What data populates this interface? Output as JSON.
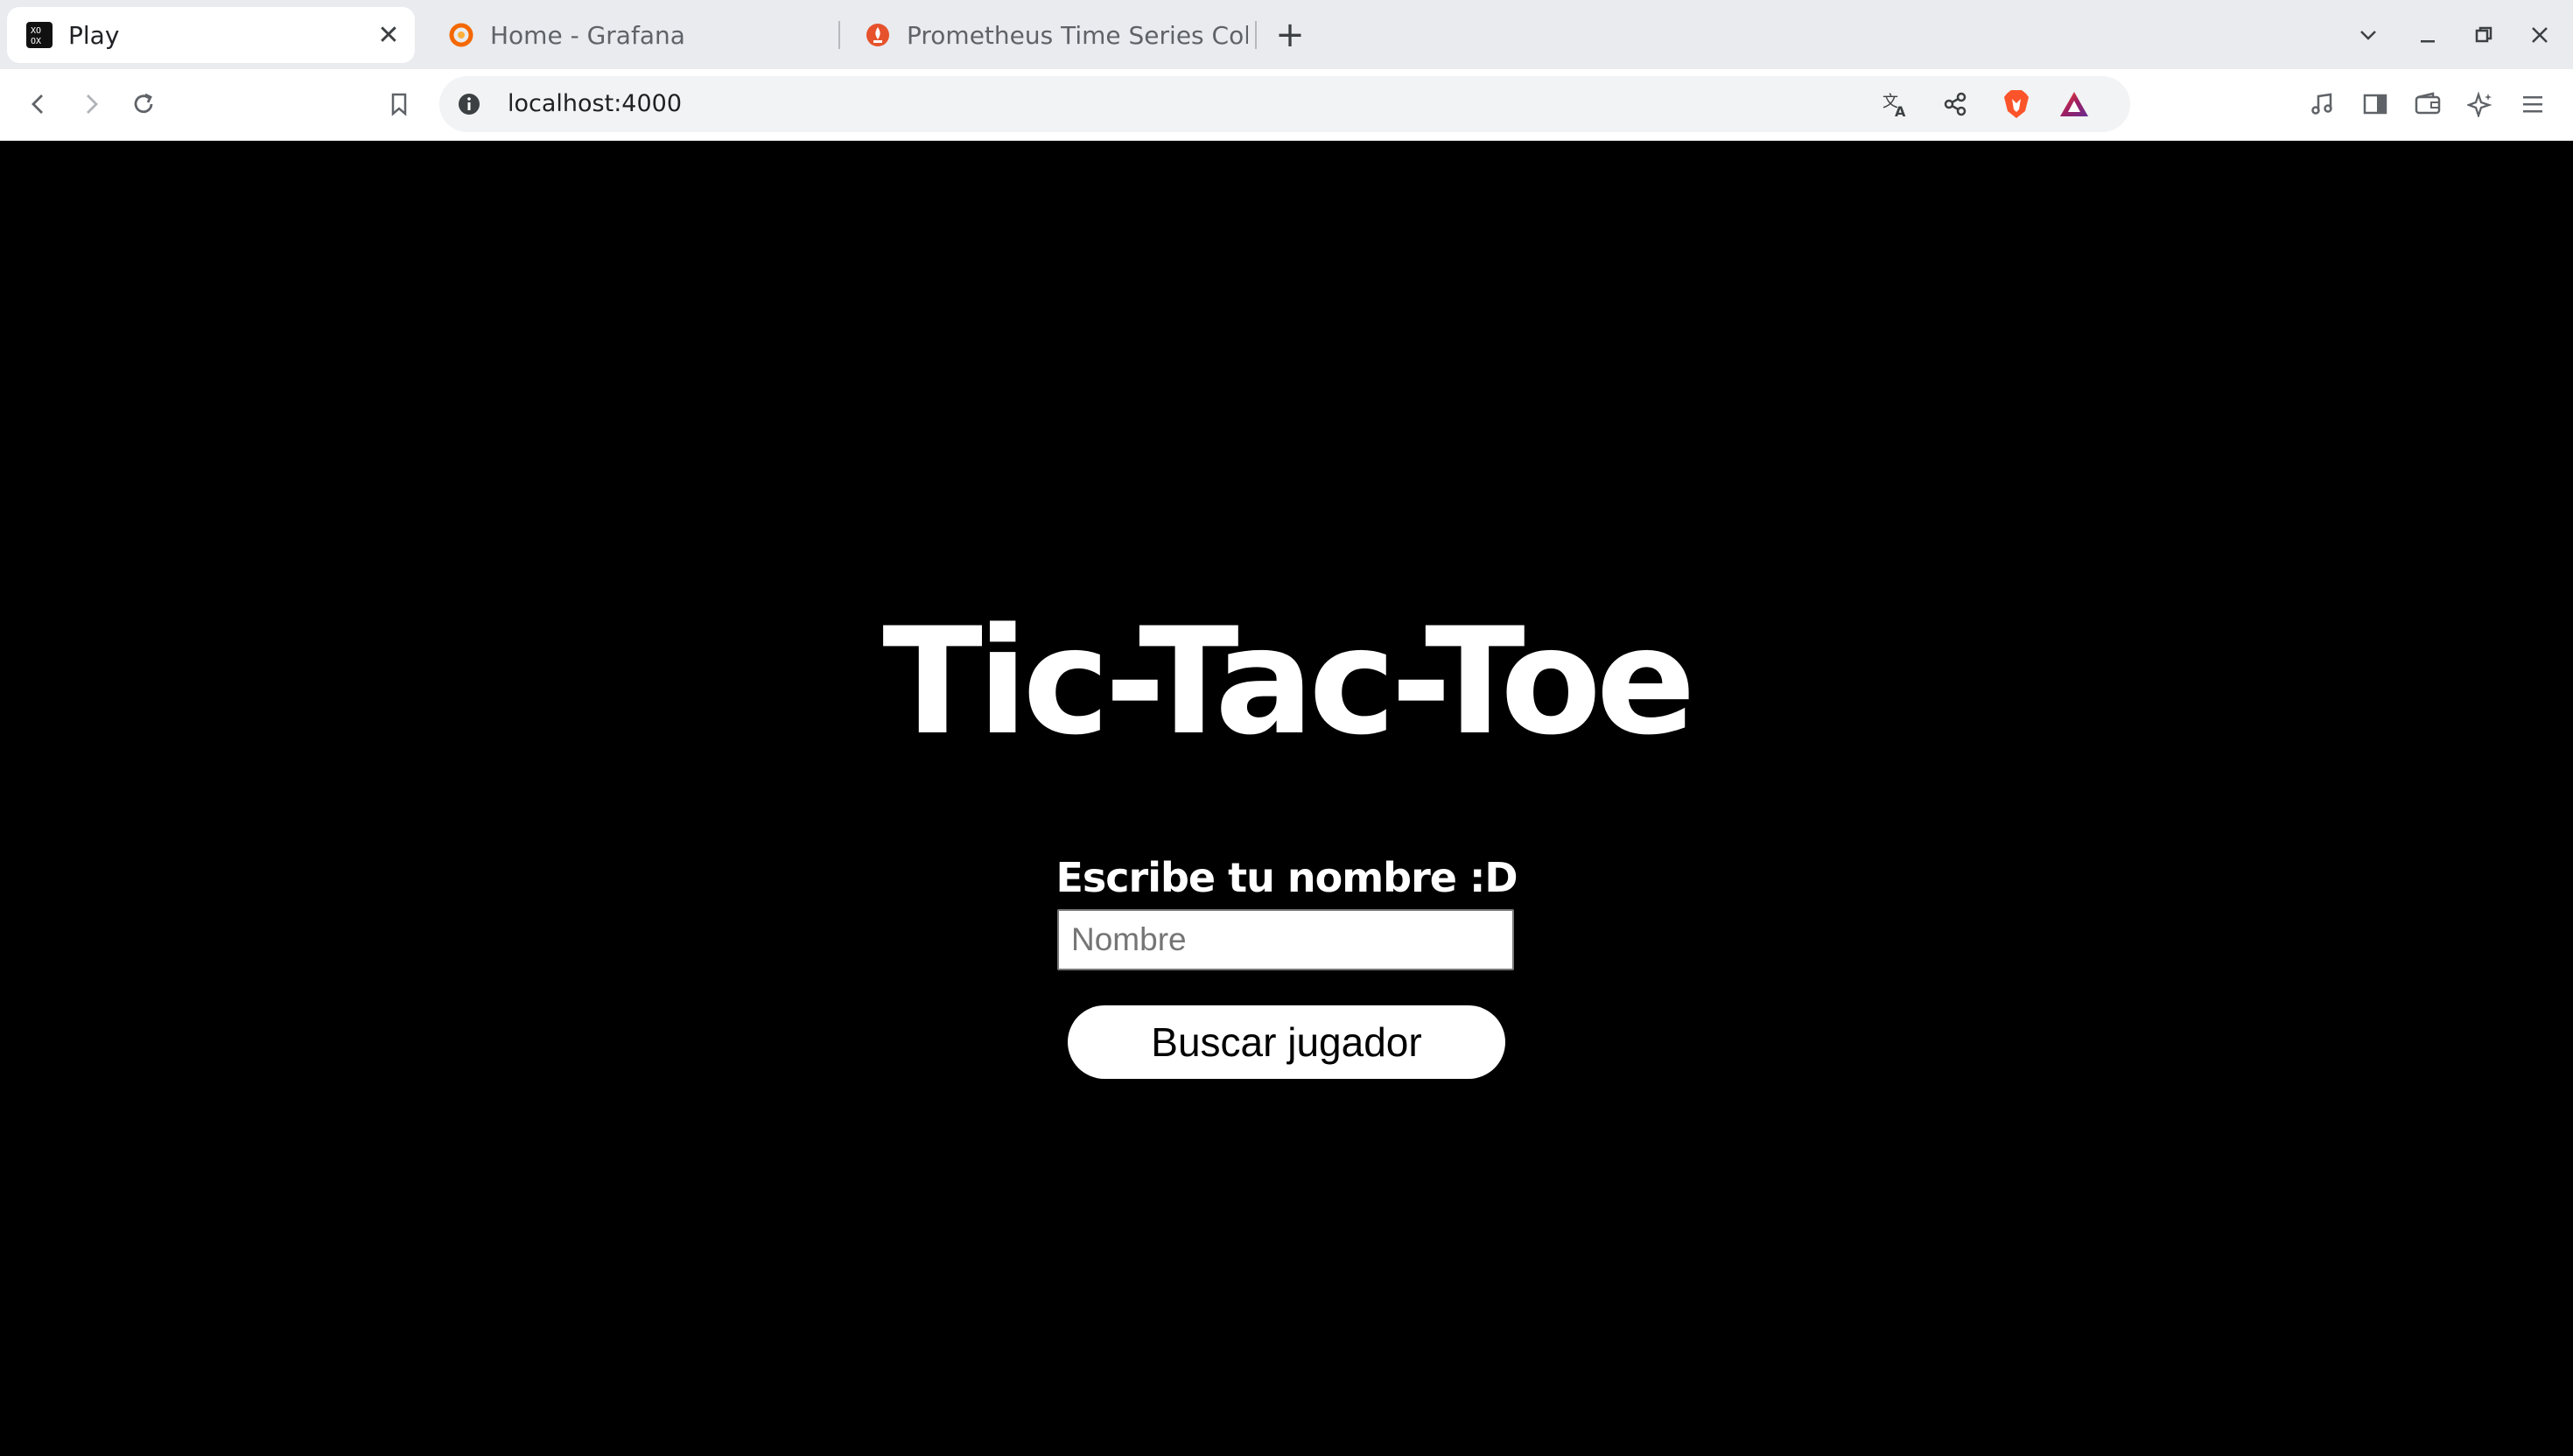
{
  "browser": {
    "tabs": [
      {
        "label": "Play",
        "icon": "app-favicon-icon",
        "active": true
      },
      {
        "label": "Home - Grafana",
        "icon": "grafana-icon",
        "active": false
      },
      {
        "label": "Prometheus Time Series Col",
        "icon": "prometheus-icon",
        "active": false
      }
    ],
    "url": "localhost:4000",
    "accent_brave": "#fb542b"
  },
  "page": {
    "title": "Tic-Tac-Toe",
    "prompt": "Escribe tu nombre :D",
    "name_input": {
      "placeholder": "Nombre",
      "value": ""
    },
    "search_button": "Buscar jugador",
    "background": "#000000"
  }
}
